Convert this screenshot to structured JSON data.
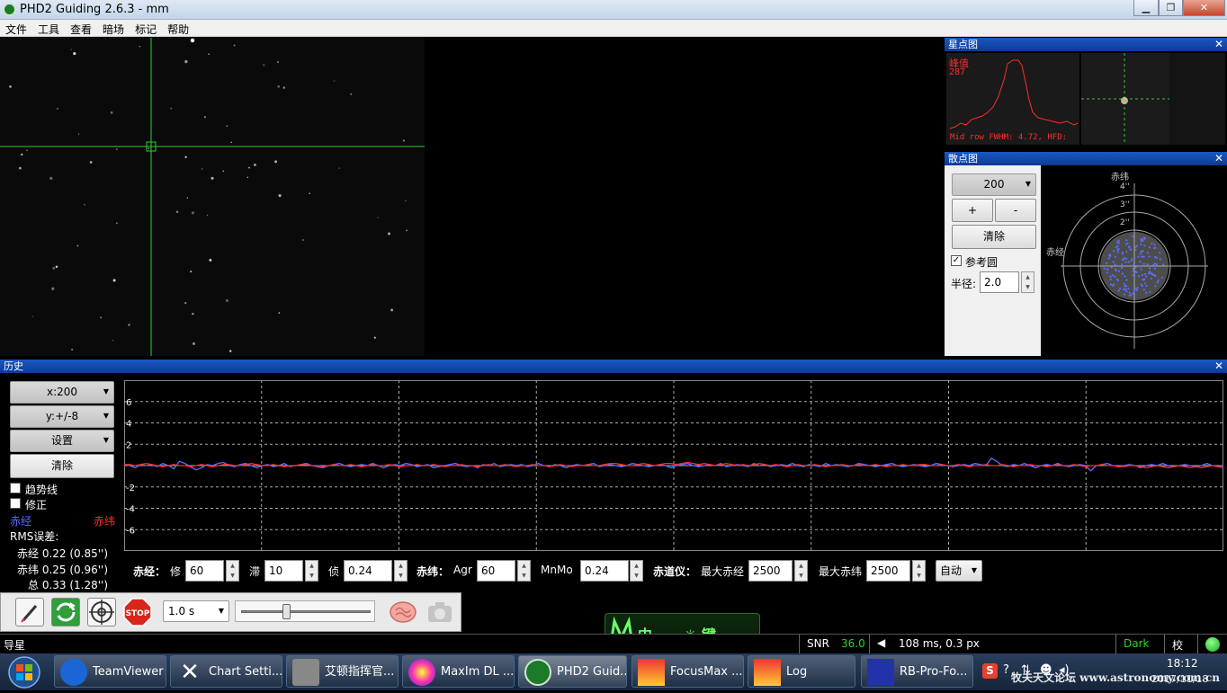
{
  "window": {
    "title": "PHD2 Guiding 2.6.3 - mm",
    "min_label": "▁",
    "max_label": "❐",
    "close_label": "✕"
  },
  "menu": [
    "文件",
    "工具",
    "查看",
    "暗场",
    "标记",
    "帮助"
  ],
  "star_profile": {
    "title": "星点图",
    "peak_label": "峰值",
    "peak_value": "287",
    "footer": "Mid row FWHM: 4.72, HFD:"
  },
  "scatter": {
    "title": "散点图",
    "length_value": "200",
    "plus_label": "+",
    "minus_label": "-",
    "clear_label": "清除",
    "ref_circle_label": "参考圆",
    "ref_circle_checked": true,
    "radius_label": "半径:",
    "radius_value": "2.0",
    "dec_label": "赤纬",
    "ra_label": "赤经",
    "ring_labels": [
      "4''",
      "3''",
      "2''"
    ]
  },
  "history": {
    "title": "历史",
    "x_scale": "x:200",
    "y_scale": "y:+/-8",
    "settings_label": "设置",
    "clear_label": "清除",
    "trend_label": "趋势线",
    "correction_label": "修正",
    "ra_legend": "赤经",
    "dec_legend": "赤纬",
    "rms_label": "RMS误差:",
    "rms_ra": "赤经 0.22 (0.85'')",
    "rms_dec": "赤纬 0.25 (0.96'')",
    "rms_total": "总 0.33 (1.28'')",
    "y_ticks": [
      "6",
      "4",
      "2",
      "-2",
      "-4",
      "-6"
    ]
  },
  "guide_params": {
    "ra_label": "赤经：",
    "hyst_label": "修",
    "hyst_value": "60",
    "agg_label": "滞",
    "agg_value": "10",
    "minmo_label": "侦",
    "minmo_value": "0.24",
    "dec_label": "赤纬：",
    "dec_agr_label": "Agr",
    "dec_agr_value": "60",
    "dec_minmo_label": "MnMo",
    "dec_minmo_value": "0.24",
    "mount_label": "赤道仪：",
    "max_ra_label": "最大赤经",
    "max_ra_value": "2500",
    "max_dec_label": "最大赤纬",
    "max_dec_value": "2500",
    "dec_mode": "自动"
  },
  "toolbar": {
    "exposure": "1.0 s",
    "stop_label": "STOP"
  },
  "ime": {
    "text": "中 ，。 ☼ 键"
  },
  "status": {
    "left": "导星",
    "snr_label": "SNR",
    "snr_value": "36.0",
    "guide_info": "108 ms, 0.3 px",
    "dark_label": "Dark",
    "cal_label": "校"
  },
  "taskbar": {
    "items": [
      "TeamViewer",
      "Chart Setti...",
      "艾顿指挥官...",
      "MaxIm DL ...",
      "PHD2 Guid...",
      "FocusMax ...",
      "Log",
      "RB-Pro-Fo..."
    ],
    "clock_time": "18:12",
    "clock_date": "2017/11/18",
    "watermark": "牧夫天文论坛 www.astronomy.com.cn"
  },
  "colors": {
    "ra": "#5a6cff",
    "dec": "#ff2b2b",
    "green": "#2bd12b",
    "panel_blue": "#0b3b93"
  },
  "chart_data": {
    "type": "line",
    "title": "",
    "xlabel": "",
    "ylabel": "",
    "ylim": [
      -8,
      8
    ],
    "x_points": 200,
    "grid": true,
    "series": [
      {
        "name": "赤经",
        "values": [
          0.1,
          0.0,
          -0.2,
          0.1,
          0.0,
          0.1,
          -0.1,
          0.2,
          0.0,
          -0.3,
          0.4,
          0.2,
          -0.1,
          -0.4,
          -0.2,
          0.1,
          0.0,
          0.2,
          0.3,
          0.0,
          -0.1,
          0.1,
          0.2,
          0.0,
          -0.2,
          0.0,
          0.1,
          -0.1,
          0.0,
          0.2,
          -0.1,
          0.0,
          0.1,
          0.2,
          0.0,
          -0.1,
          -0.2,
          0.0,
          0.1,
          0.2,
          0.0,
          -0.1,
          0.0,
          0.1,
          0.0,
          0.2,
          0.0,
          -0.2,
          0.0,
          0.1,
          0.0,
          0.2,
          0.1,
          -0.1,
          0.0,
          0.1,
          -0.2,
          -0.1,
          0.0,
          0.1,
          0.2,
          0.0,
          -0.1,
          0.0,
          -0.2,
          0.1,
          0.0,
          0.2,
          -0.1,
          0.0,
          0.1,
          0.0,
          0.1,
          -0.1,
          0.0,
          0.2,
          0.0,
          -0.1,
          0.1,
          0.0,
          -0.2,
          0.0,
          0.1,
          0.0,
          0.1,
          0.2,
          -0.1,
          0.0,
          0.1,
          0.0,
          -0.1,
          0.0,
          0.2,
          0.1,
          0.0,
          -0.1,
          0.0,
          0.1,
          0.0,
          -0.2,
          0.0,
          0.1,
          0.2,
          0.0,
          -0.1,
          0.0,
          0.1,
          0.0,
          0.2,
          -0.1,
          0.0,
          0.1,
          0.0,
          -0.1,
          0.2,
          0.0,
          0.1,
          -0.1,
          0.0,
          0.1,
          0.0,
          0.2,
          0.0,
          -0.1,
          0.1,
          0.0,
          -0.1,
          0.2,
          0.0,
          0.1,
          0.0,
          -0.1,
          0.0,
          0.2,
          0.1,
          0.0,
          -0.1,
          0.0,
          0.1,
          0.2,
          0.0,
          -0.1,
          0.0,
          0.1,
          0.0,
          -0.1,
          0.0,
          0.2,
          0.1,
          0.0,
          -0.1,
          0.0,
          0.1,
          0.0,
          0.2,
          0.1,
          0.0,
          0.7,
          0.4,
          0.0,
          -0.1,
          0.1,
          0.0,
          0.2,
          0.0,
          -0.2,
          0.0,
          0.1,
          0.0,
          0.2,
          0.0,
          -0.1,
          0.0,
          0.1,
          0.0,
          -0.5,
          0.0,
          0.1,
          0.2,
          0.0,
          -0.1,
          0.0,
          0.1,
          0.0,
          -0.2,
          0.0,
          0.1,
          0.0,
          0.2,
          0.0,
          -0.1,
          0.0,
          0.1,
          0.0,
          -0.1,
          0.0,
          0.2,
          0.0,
          -0.1,
          0.0
        ]
      },
      {
        "name": "赤纬",
        "values": [
          0.1,
          0.1,
          0.0,
          0.1,
          0.2,
          0.1,
          0.0,
          -0.1,
          0.0,
          0.1,
          0.0,
          0.0,
          -0.1,
          0.0,
          0.1,
          0.0,
          -0.1,
          0.0,
          0.1,
          0.1,
          0.0,
          0.0,
          0.1,
          0.2,
          0.1,
          0.0,
          0.0,
          0.1,
          0.0,
          -0.1,
          0.0,
          0.0,
          0.1,
          0.1,
          0.0,
          0.0,
          -0.1,
          0.0,
          0.1,
          0.0,
          0.0,
          0.1,
          0.0,
          -0.1,
          0.0,
          0.1,
          0.0,
          0.0,
          0.1,
          0.0,
          -0.1,
          0.0,
          0.0,
          0.1,
          0.0,
          0.0,
          0.1,
          0.0,
          -0.1,
          0.0,
          0.0,
          0.1,
          0.0,
          0.0,
          -0.1,
          0.0,
          0.1,
          0.0,
          0.0,
          0.1,
          0.0,
          -0.1,
          0.0,
          0.0,
          0.1,
          0.0,
          0.0,
          -0.1,
          0.0,
          0.1,
          0.0,
          -0.1,
          0.0,
          0.0,
          0.1,
          0.0,
          0.0,
          0.1,
          0.2,
          0.2,
          0.1,
          0.0,
          0.0,
          0.1,
          0.2,
          0.1,
          0.0,
          0.1,
          0.2,
          0.2,
          0.1,
          0.2,
          0.3,
          0.2,
          0.1,
          0.2,
          0.1,
          0.0,
          0.1,
          0.2,
          0.1,
          0.0,
          0.1,
          0.0,
          0.1,
          0.2,
          0.1,
          0.0,
          0.1,
          0.0,
          -0.1,
          0.0,
          0.1,
          0.0,
          0.0,
          0.1,
          0.0,
          -0.1,
          0.0,
          0.0,
          0.1,
          0.0,
          0.0,
          0.1,
          0.0,
          0.0,
          0.1,
          0.0,
          -0.1,
          0.0,
          0.0,
          0.1,
          0.0,
          0.0,
          0.1,
          0.1,
          0.0,
          0.0,
          0.1,
          0.0,
          0.0,
          0.1,
          0.0,
          -0.1,
          0.0,
          0.0,
          0.1,
          0.0,
          0.0,
          0.1,
          0.0,
          -0.1,
          0.0,
          0.0,
          0.1,
          0.0,
          0.0,
          -0.1,
          0.0,
          0.1,
          0.0,
          0.0,
          0.1,
          0.0,
          -0.1,
          0.0,
          0.0,
          0.1,
          0.0,
          0.0,
          -0.1,
          -0.1,
          0.0,
          0.0,
          -0.1,
          -0.2,
          -0.1,
          0.0,
          -0.1,
          -0.2,
          -0.1,
          0.0,
          -0.1,
          -0.2,
          -0.1,
          -0.2,
          -0.1,
          0.0,
          -0.1,
          -0.2
        ]
      }
    ]
  }
}
